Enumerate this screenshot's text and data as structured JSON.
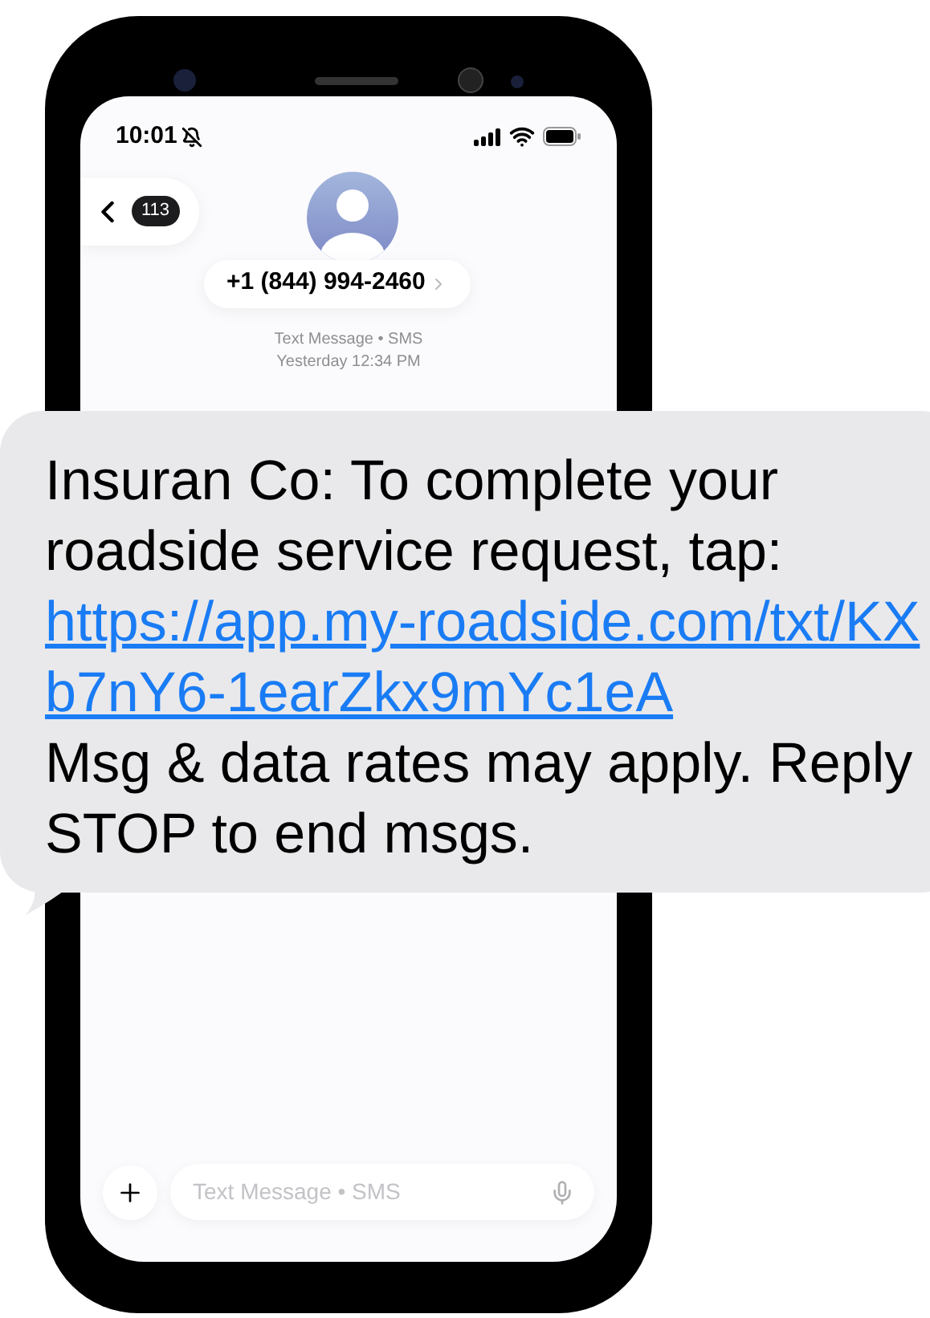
{
  "status_bar": {
    "time": "10:01"
  },
  "header": {
    "back_count": "113",
    "contact": "+1 (844) 994-2460"
  },
  "thread": {
    "service": "Text Message • SMS",
    "timestamp": "Yesterday 12:34 PM"
  },
  "message": {
    "text_before": "Insuran Co: To complete your roadside service request, tap:",
    "link": "https://app.my-roadside.com/txt/KXb7nY6-1earZkx9mYc1eA",
    "text_after": "Msg & data rates may apply. Reply STOP to end msgs."
  },
  "composer": {
    "placeholder": "Text Message • SMS"
  }
}
